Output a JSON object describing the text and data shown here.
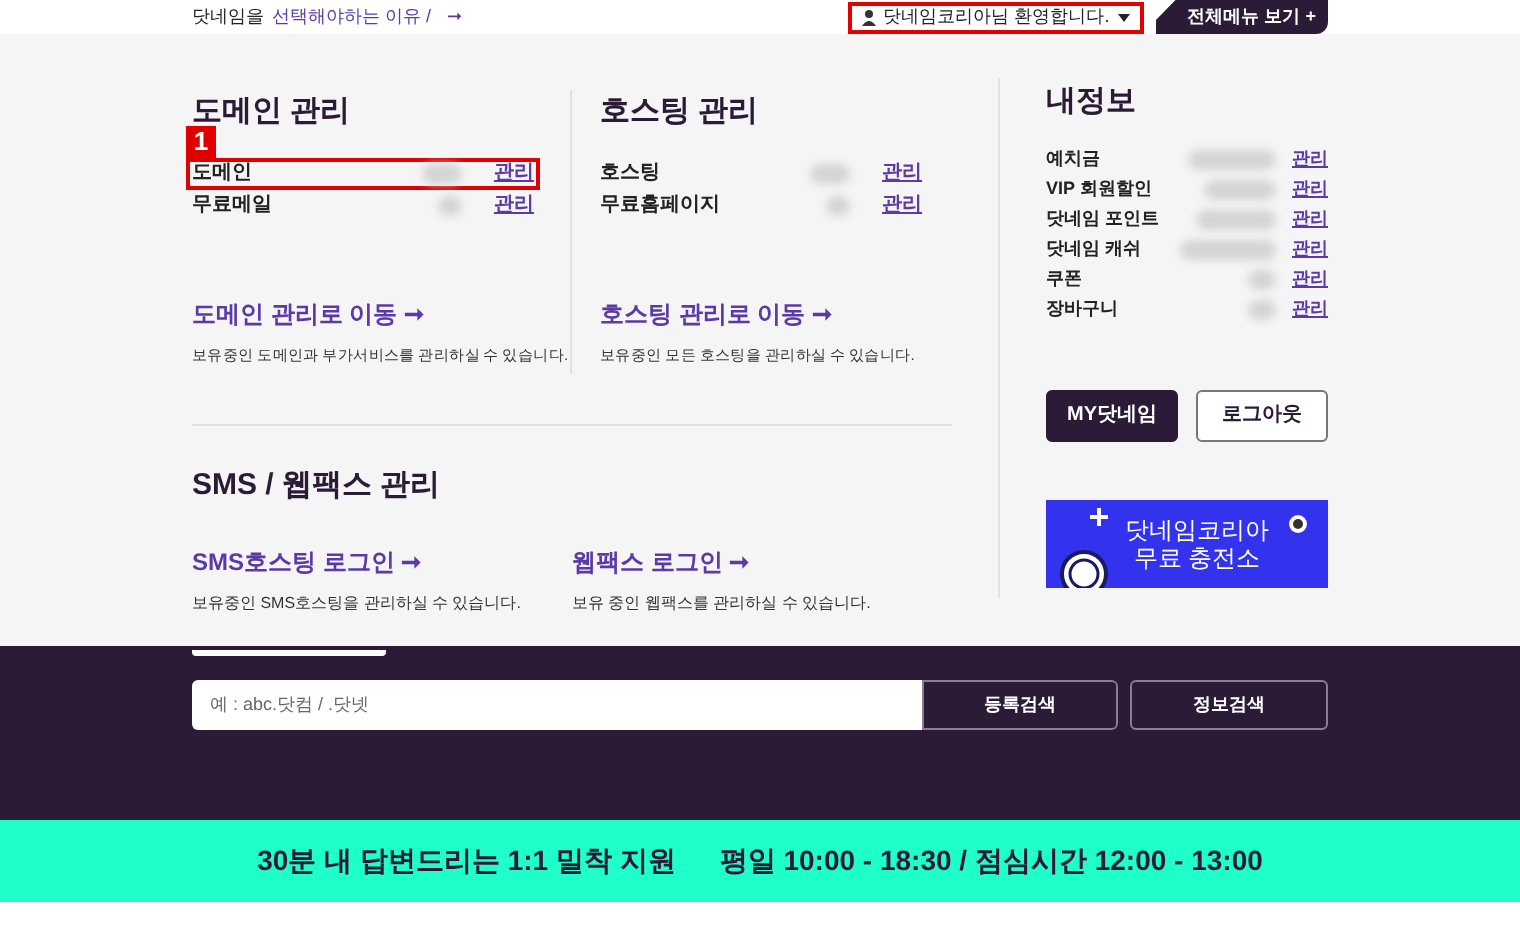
{
  "top_bar": {
    "reason_prefix": "닷네임을",
    "reason_link": "선택해야하는 이유 /",
    "reason_arrow": "➞",
    "welcome": {
      "label": "닷네임코리아님 환영합니다.",
      "highlighted": true
    },
    "all_menu": "전체메뉴 보기 +"
  },
  "domain": {
    "title": "도메인 관리",
    "rows": [
      {
        "label": "도메인",
        "action": "관리",
        "highlighted": true,
        "marker": "1"
      },
      {
        "label": "무료메일",
        "action": "관리",
        "highlighted": false
      }
    ],
    "move_link": "도메인 관리로 이동 ➞",
    "description": "보유중인 도메인과 부가서비스를 관리하실 수 있습니다."
  },
  "hosting": {
    "title": "호스팅 관리",
    "rows": [
      {
        "label": "호스팅",
        "action": "관리"
      },
      {
        "label": "무료홈페이지",
        "action": "관리"
      }
    ],
    "move_link": "호스팅 관리로 이동 ➞",
    "description": "보유중인 모든 호스팅을 관리하실 수 있습니다."
  },
  "sms_webfax": {
    "title": "SMS / 웹팩스 관리",
    "links": [
      {
        "label": "SMS호스팅 로그인 ➞",
        "description": "보유중인 SMS호스팅을 관리하실 수 있습니다."
      },
      {
        "label": "웹팩스 로그인 ➞",
        "description": "보유 중인 웹팩스를 관리하실 수 있습니다."
      }
    ]
  },
  "my_info": {
    "title": "내정보",
    "rows": [
      {
        "label": "예치금",
        "action": "관리"
      },
      {
        "label": "VIP 회원할인",
        "action": "관리"
      },
      {
        "label": "닷네임 포인트",
        "action": "관리"
      },
      {
        "label": "닷네임 캐쉬",
        "action": "관리"
      },
      {
        "label": "쿠폰",
        "action": "관리"
      },
      {
        "label": "장바구니",
        "action": "관리"
      }
    ],
    "buttons": [
      {
        "label": "MY닷네임",
        "kind": "primary"
      },
      {
        "label": "로그아웃",
        "kind": "outline"
      }
    ],
    "banner": {
      "line1": "닷네임코리아",
      "line2": "무료 충전소"
    }
  },
  "search": {
    "placeholder": "예 : abc.닷컴 / .닷넷",
    "buttons": [
      "등록검색",
      "정보검색"
    ]
  },
  "support_bar": {
    "left": "30분 내 답변드리는 1:1 밀착 지원",
    "right": "평일 10:00 - 18:30 / 점심시간 12:00 - 13:00"
  }
}
